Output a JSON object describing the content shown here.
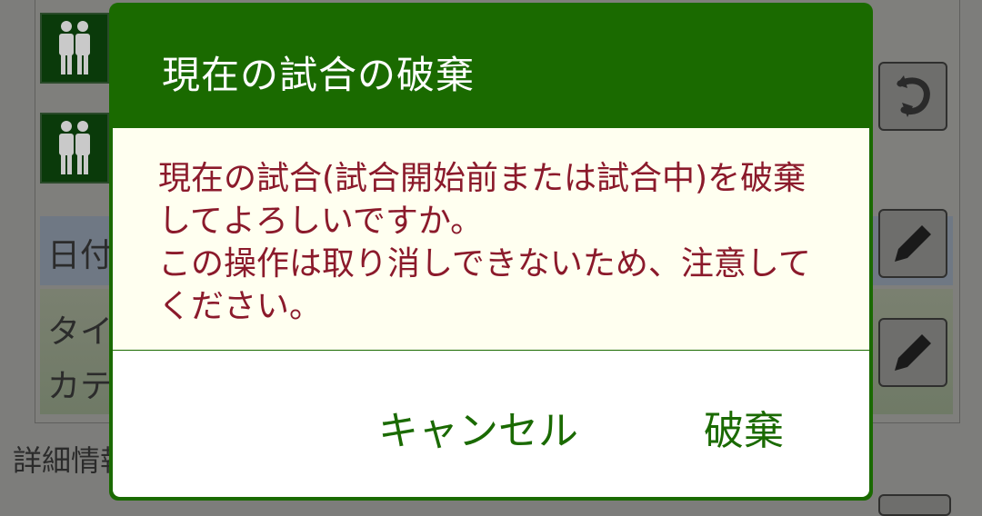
{
  "background": {
    "date_row_label": "日付",
    "title_row_label_1": "タイ",
    "title_row_label_2": "カテ",
    "details_label": "詳細情報",
    "icons": [
      "players-icon",
      "players-icon",
      "undo-icon",
      "edit-icon",
      "edit-icon"
    ]
  },
  "dialog": {
    "title": "現在の試合の破棄",
    "message": "現在の試合(試合開始前または試合中)を破棄してよろしいですか。\nこの操作は取り消しできないため、注意してください。",
    "cancel_label": "キャンセル",
    "discard_label": "破棄"
  },
  "colors": {
    "dialog_header": "#1a6a00",
    "message_text": "#8b1a2b",
    "message_background": "#fffff0",
    "button_text": "#1a6a00"
  }
}
